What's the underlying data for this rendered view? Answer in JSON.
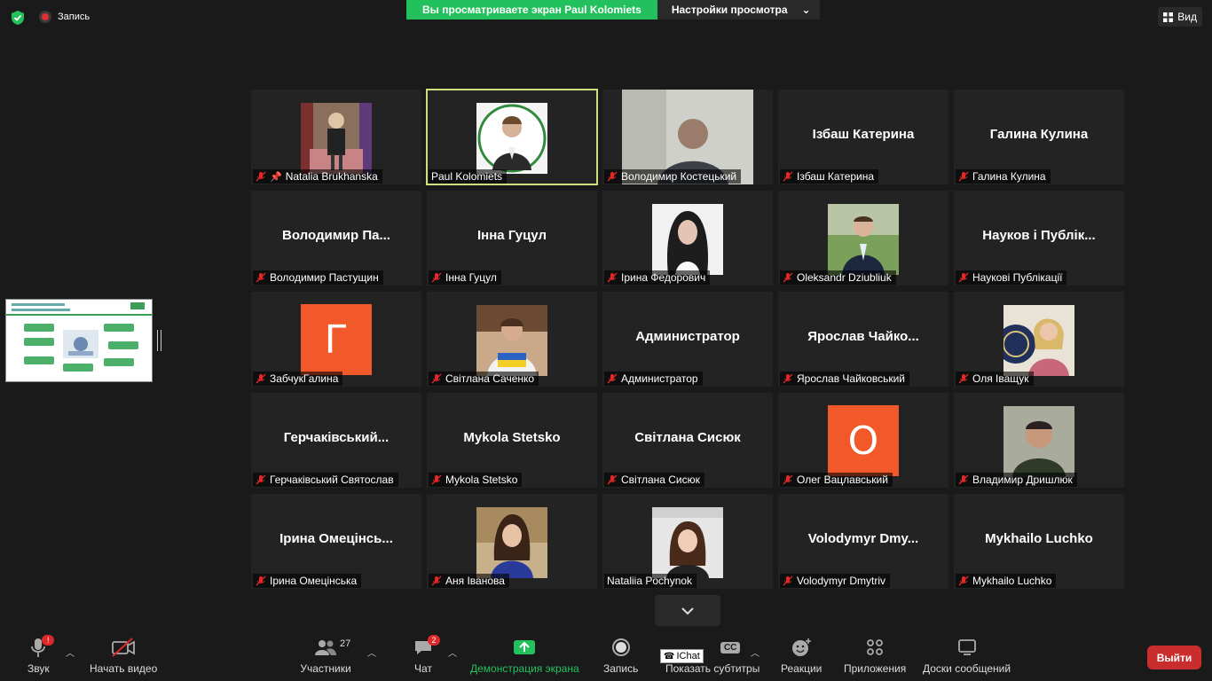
{
  "top": {
    "recording_label": "Запись",
    "banner_text": "Вы просматриваете экран Paul Kolomiets",
    "view_options_label": "Настройки просмотра",
    "view_button_label": "Вид"
  },
  "tiles": [
    {
      "label": "Natalia Brukhanska",
      "pinned": true,
      "display": "photo"
    },
    {
      "label": "Paul Kolomiets",
      "active": true,
      "display": "photo"
    },
    {
      "label": "Володимир Костецький",
      "display": "photo-wide"
    },
    {
      "label": "Ізбаш Катерина",
      "big": "Ізбаш Катерина"
    },
    {
      "label": "Галина Кулина",
      "big": "Галина Кулина"
    },
    {
      "label": "Володимир Пастущин",
      "big": "Володимир  Па..."
    },
    {
      "label": "Інна Гуцул",
      "big": "Інна Гуцул"
    },
    {
      "label": "Ірина Федорович",
      "display": "photo"
    },
    {
      "label": "Oleksandr Dziubliuk",
      "display": "photo"
    },
    {
      "label": "Наукові Публікації",
      "big": "Науков і Публік..."
    },
    {
      "label": "ЗабчукГалина",
      "letter": "Г"
    },
    {
      "label": "Світлана Саченко",
      "display": "photo"
    },
    {
      "label": "Администратор",
      "big": "Администратор"
    },
    {
      "label": "Ярослав Чайковський",
      "big": "Ярослав  Чайко..."
    },
    {
      "label": "Оля Іващук",
      "display": "photo"
    },
    {
      "label": "Герчаківський Святослав",
      "big": "Герчаківський..."
    },
    {
      "label": "Mykola Stetsko",
      "big": "Mykola Stetsko"
    },
    {
      "label": "Світлана Сисюк",
      "big": "Світлана Сисюк"
    },
    {
      "label": "Олег Вацлавський",
      "letter": "О"
    },
    {
      "label": "Владимир Дришлюк",
      "display": "photo"
    },
    {
      "label": "Ірина Омецінська",
      "big": "Ірина  Омецінсь..."
    },
    {
      "label": "Аня Іванова",
      "display": "photo"
    },
    {
      "label": "Nataliia Pochynok",
      "display": "photo"
    },
    {
      "label": "Volodymyr Dmytriv",
      "big": "Volodymyr  Dmy..."
    },
    {
      "label": "Mykhailo Luchko",
      "big": "Mykhailo Luchko"
    }
  ],
  "toolbar": {
    "audio": "Звук",
    "video": "Начать видео",
    "participants": "Участники",
    "participants_count": "27",
    "chat": "Чат",
    "chat_badge": "2",
    "share": "Демонстрация экрана",
    "record": "Запись",
    "captions": "Показать субтитры",
    "reactions": "Реакции",
    "apps": "Приложения",
    "whiteboards": "Доски сообщений",
    "leave": "Выйти",
    "ichat": "IChat",
    "cc": "CC"
  },
  "colors": {
    "green": "#23c15d",
    "leave": "#c92d2d",
    "active_border": "#cfe07a",
    "avatar_orange": "#f2592a"
  }
}
